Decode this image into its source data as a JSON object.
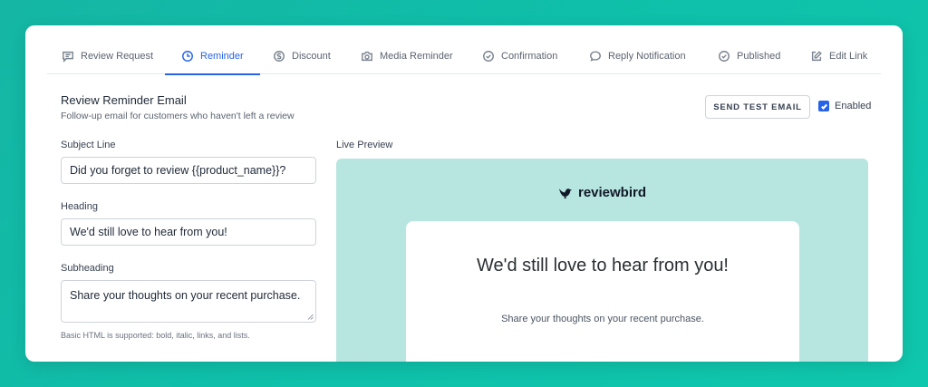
{
  "tabs": [
    {
      "label": "Review Request",
      "icon": "chat-icon"
    },
    {
      "label": "Reminder",
      "icon": "clock-icon",
      "active": true
    },
    {
      "label": "Discount",
      "icon": "dollar-icon"
    },
    {
      "label": "Media Reminder",
      "icon": "camera-icon"
    },
    {
      "label": "Confirmation",
      "icon": "check-circle-icon"
    },
    {
      "label": "Reply Notification",
      "icon": "chat-bubble-icon"
    },
    {
      "label": "Published",
      "icon": "check-circle-icon"
    },
    {
      "label": "Edit Link",
      "icon": "edit-icon"
    }
  ],
  "section": {
    "title": "Review Reminder Email",
    "subtitle": "Follow-up email for customers who haven't left a review"
  },
  "actions": {
    "send_test_label": "SEND TEST EMAIL",
    "enabled_label": "Enabled",
    "enabled_checked": true
  },
  "form": {
    "subject_label": "Subject Line",
    "subject_value": "Did you forget to review {{product_name}}?",
    "heading_label": "Heading",
    "heading_value": "We'd still love to hear from you!",
    "subheading_label": "Subheading",
    "subheading_value": "Share your thoughts on your recent purchase.",
    "hint": "Basic HTML is supported: bold, italic, links, and lists."
  },
  "preview": {
    "label": "Live Preview",
    "brand": "reviewbird",
    "heading": "We'd still love to hear from you!",
    "subheading": "Share your thoughts on your recent purchase."
  },
  "colors": {
    "accent": "#2563eb",
    "preview_bg": "#b7e5e0",
    "page_bg": "#0fbfa9"
  }
}
